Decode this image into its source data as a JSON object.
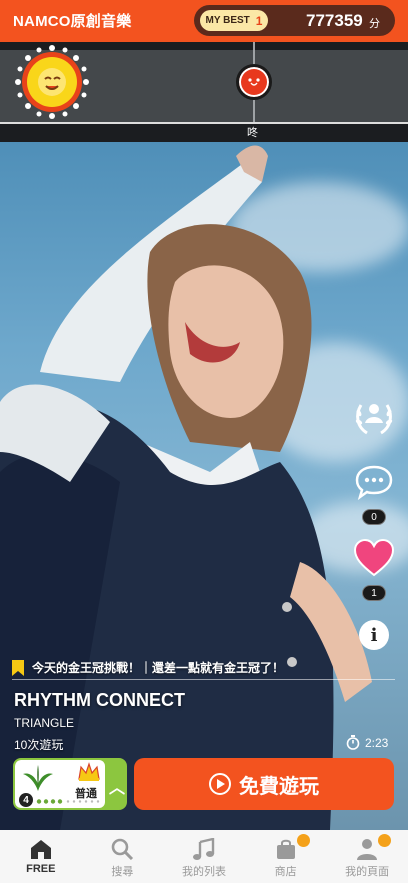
{
  "header": {
    "app_title": "NAMCO原創音樂",
    "my_best_label": "MY BEST",
    "my_best_rank": "1",
    "score": "777359",
    "score_unit": "分"
  },
  "lane": {
    "note_label": "咚"
  },
  "side": {
    "comment_count": "0",
    "like_count": "1"
  },
  "ticker": {
    "text": "今天的金王冠挑戰！｜還差一點就有金王冠了！"
  },
  "song": {
    "title": "RHYTHM CONNECT",
    "artist": "TRIANGLE",
    "play_count": "10次遊玩",
    "duration": "2:23"
  },
  "difficulty": {
    "level": "4",
    "label": "普通"
  },
  "play_button": {
    "label": "免費遊玩"
  },
  "nav": {
    "items": [
      {
        "label": "FREE",
        "icon": "home-icon",
        "active": true
      },
      {
        "label": "搜尋",
        "icon": "search-icon"
      },
      {
        "label": "我的列表",
        "icon": "music-note-icon"
      },
      {
        "label": "商店",
        "icon": "shop-bag-icon",
        "badge": true
      },
      {
        "label": "我的頁面",
        "icon": "person-icon",
        "badge": true
      }
    ]
  },
  "colors": {
    "brand_orange": "#f3531f",
    "difficulty_green": "#8cc63f",
    "like_pink": "#f0457e",
    "badge_orange": "#f4a11a"
  }
}
